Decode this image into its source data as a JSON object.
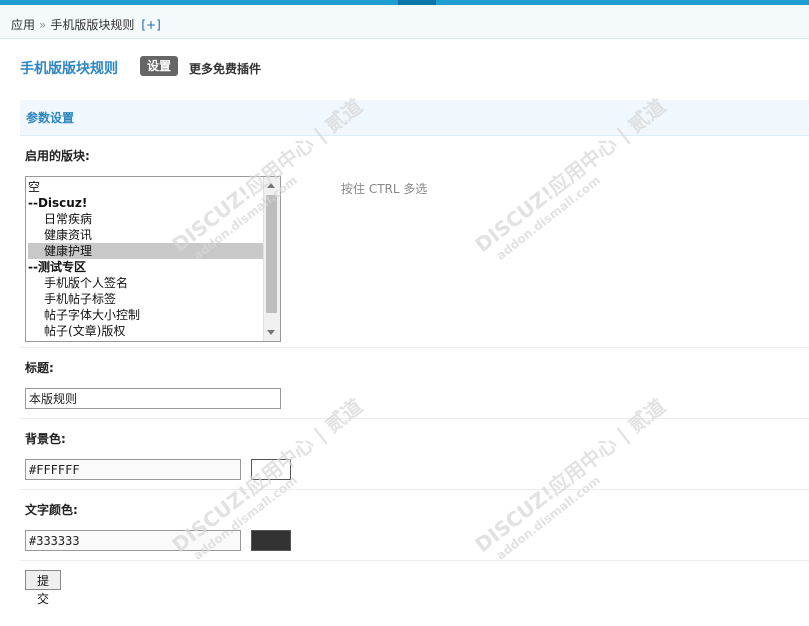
{
  "breadcrumb": {
    "root": "应用",
    "separator": "»",
    "current": "手机版版块规则",
    "add": "[+]"
  },
  "plugin": {
    "title": "手机版版块规则",
    "settings_tab": "设置",
    "more_link": "更多免费插件"
  },
  "section": {
    "title": "参数设置"
  },
  "fields": {
    "forums": {
      "label": "启用的版块:",
      "tip": "按住 CTRL 多选",
      "options": [
        {
          "label": "空",
          "group": false,
          "child": false,
          "selected": false
        },
        {
          "label": "--Discuz!",
          "group": true,
          "child": false,
          "selected": false
        },
        {
          "label": "日常疾病",
          "group": false,
          "child": true,
          "selected": false
        },
        {
          "label": "健康资讯",
          "group": false,
          "child": true,
          "selected": false
        },
        {
          "label": "健康护理",
          "group": false,
          "child": true,
          "selected": true
        },
        {
          "label": "--测试专区",
          "group": true,
          "child": false,
          "selected": false
        },
        {
          "label": "手机版个人签名",
          "group": false,
          "child": true,
          "selected": false
        },
        {
          "label": "手机帖子标签",
          "group": false,
          "child": true,
          "selected": false
        },
        {
          "label": "帖子字体大小控制",
          "group": false,
          "child": true,
          "selected": false
        },
        {
          "label": "帖子(文章)版权",
          "group": false,
          "child": true,
          "selected": false
        }
      ]
    },
    "title": {
      "label": "标题:",
      "value": "本版规则"
    },
    "bgcolor": {
      "label": "背景色:",
      "value": "#FFFFFF",
      "swatch": "#FFFFFF"
    },
    "textcolor": {
      "label": "文字颜色:",
      "value": "#333333",
      "swatch": "#333333"
    }
  },
  "submit_label": "提交",
  "watermark": {
    "brand": "DISCUZ!应用中心 | 贰道",
    "url": "addon.dismall.com"
  },
  "colors": {
    "accent": "#2e86c1",
    "topbar": "#1f9dd2"
  }
}
